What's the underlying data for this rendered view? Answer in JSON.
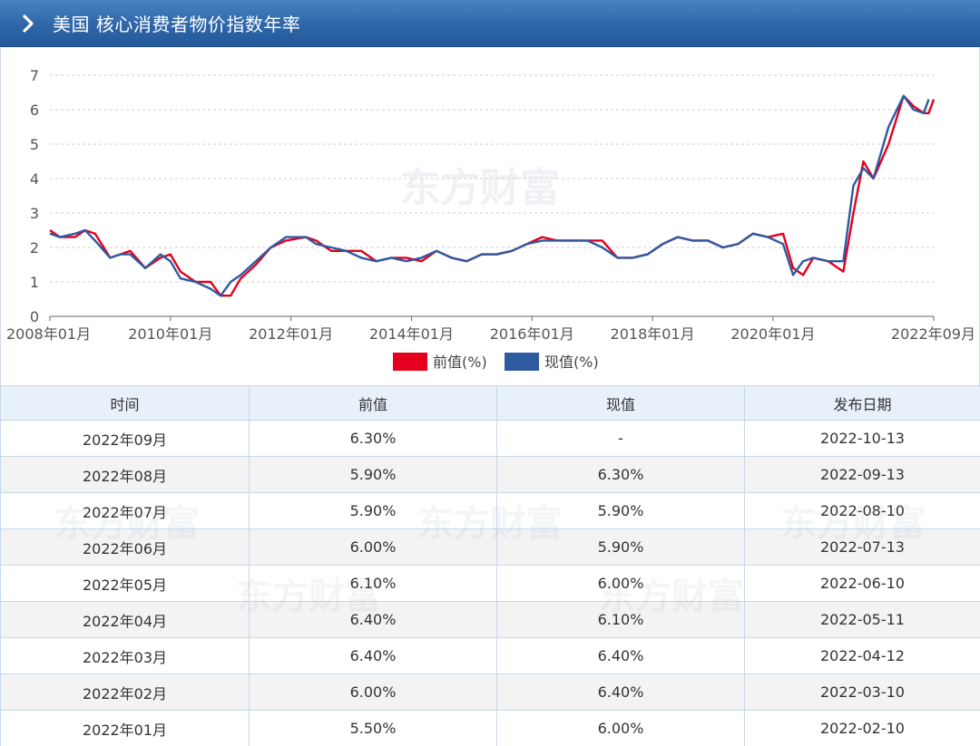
{
  "header": {
    "title": "美国 核心消费者物价指数年率"
  },
  "watermark": {
    "text": "东方财富"
  },
  "legend": {
    "prev_label": "前值(%)",
    "curr_label": "现值(%)"
  },
  "colors": {
    "prev": "#e4001c",
    "curr": "#2e5aa0",
    "header": "#2e66a8"
  },
  "chart_data": {
    "type": "line",
    "x_ticks": [
      "2008年01月",
      "2010年01月",
      "2012年01月",
      "2014年01月",
      "2016年01月",
      "2018年01月",
      "2020年01月",
      "2022年09月"
    ],
    "x_range": [
      "2008-01",
      "2022-09"
    ],
    "ylim": [
      0,
      7
    ],
    "y_ticks": [
      0,
      1,
      2,
      3,
      4,
      5,
      6,
      7
    ],
    "grid": "horizontal-dashed",
    "legend_position": "bottom",
    "series": [
      {
        "name": "前值(%)",
        "points": [
          [
            "2008-01",
            2.5
          ],
          [
            "2008-03",
            2.3
          ],
          [
            "2008-06",
            2.3
          ],
          [
            "2008-08",
            2.5
          ],
          [
            "2008-10",
            2.4
          ],
          [
            "2009-01",
            1.7
          ],
          [
            "2009-03",
            1.8
          ],
          [
            "2009-05",
            1.9
          ],
          [
            "2009-08",
            1.4
          ],
          [
            "2009-11",
            1.7
          ],
          [
            "2010-01",
            1.8
          ],
          [
            "2010-03",
            1.3
          ],
          [
            "2010-06",
            1.0
          ],
          [
            "2010-09",
            1.0
          ],
          [
            "2010-11",
            0.6
          ],
          [
            "2011-01",
            0.6
          ],
          [
            "2011-03",
            1.1
          ],
          [
            "2011-06",
            1.5
          ],
          [
            "2011-09",
            2.0
          ],
          [
            "2011-12",
            2.2
          ],
          [
            "2012-04",
            2.3
          ],
          [
            "2012-06",
            2.2
          ],
          [
            "2012-09",
            1.9
          ],
          [
            "2012-12",
            1.9
          ],
          [
            "2013-03",
            1.9
          ],
          [
            "2013-06",
            1.6
          ],
          [
            "2013-09",
            1.7
          ],
          [
            "2013-12",
            1.7
          ],
          [
            "2014-03",
            1.6
          ],
          [
            "2014-06",
            1.9
          ],
          [
            "2014-09",
            1.7
          ],
          [
            "2014-12",
            1.6
          ],
          [
            "2015-03",
            1.8
          ],
          [
            "2015-06",
            1.8
          ],
          [
            "2015-09",
            1.9
          ],
          [
            "2015-12",
            2.1
          ],
          [
            "2016-03",
            2.3
          ],
          [
            "2016-06",
            2.2
          ],
          [
            "2016-09",
            2.2
          ],
          [
            "2016-12",
            2.2
          ],
          [
            "2017-03",
            2.2
          ],
          [
            "2017-06",
            1.7
          ],
          [
            "2017-09",
            1.7
          ],
          [
            "2017-12",
            1.8
          ],
          [
            "2018-03",
            2.1
          ],
          [
            "2018-06",
            2.3
          ],
          [
            "2018-09",
            2.2
          ],
          [
            "2018-12",
            2.2
          ],
          [
            "2019-03",
            2.0
          ],
          [
            "2019-06",
            2.1
          ],
          [
            "2019-09",
            2.4
          ],
          [
            "2019-12",
            2.3
          ],
          [
            "2020-03",
            2.4
          ],
          [
            "2020-05",
            1.4
          ],
          [
            "2020-07",
            1.2
          ],
          [
            "2020-09",
            1.7
          ],
          [
            "2020-12",
            1.6
          ],
          [
            "2021-03",
            1.3
          ],
          [
            "2021-05",
            3.0
          ],
          [
            "2021-07",
            4.5
          ],
          [
            "2021-09",
            4.0
          ],
          [
            "2021-12",
            5.0
          ],
          [
            "2022-03",
            6.4
          ],
          [
            "2022-05",
            6.1
          ],
          [
            "2022-07",
            5.9
          ],
          [
            "2022-08",
            5.9
          ],
          [
            "2022-09",
            6.3
          ]
        ]
      },
      {
        "name": "现值(%)",
        "points": [
          [
            "2008-01",
            2.4
          ],
          [
            "2008-03",
            2.3
          ],
          [
            "2008-06",
            2.4
          ],
          [
            "2008-08",
            2.5
          ],
          [
            "2008-10",
            2.2
          ],
          [
            "2009-01",
            1.7
          ],
          [
            "2009-03",
            1.8
          ],
          [
            "2009-05",
            1.8
          ],
          [
            "2009-08",
            1.4
          ],
          [
            "2009-11",
            1.8
          ],
          [
            "2010-01",
            1.6
          ],
          [
            "2010-03",
            1.1
          ],
          [
            "2010-06",
            1.0
          ],
          [
            "2010-09",
            0.8
          ],
          [
            "2010-11",
            0.6
          ],
          [
            "2011-01",
            1.0
          ],
          [
            "2011-03",
            1.2
          ],
          [
            "2011-06",
            1.6
          ],
          [
            "2011-09",
            2.0
          ],
          [
            "2011-12",
            2.3
          ],
          [
            "2012-04",
            2.3
          ],
          [
            "2012-06",
            2.1
          ],
          [
            "2012-09",
            2.0
          ],
          [
            "2012-12",
            1.9
          ],
          [
            "2013-03",
            1.7
          ],
          [
            "2013-06",
            1.6
          ],
          [
            "2013-09",
            1.7
          ],
          [
            "2013-12",
            1.6
          ],
          [
            "2014-03",
            1.7
          ],
          [
            "2014-06",
            1.9
          ],
          [
            "2014-09",
            1.7
          ],
          [
            "2014-12",
            1.6
          ],
          [
            "2015-03",
            1.8
          ],
          [
            "2015-06",
            1.8
          ],
          [
            "2015-09",
            1.9
          ],
          [
            "2015-12",
            2.1
          ],
          [
            "2016-03",
            2.2
          ],
          [
            "2016-06",
            2.2
          ],
          [
            "2016-09",
            2.2
          ],
          [
            "2016-12",
            2.2
          ],
          [
            "2017-03",
            2.0
          ],
          [
            "2017-06",
            1.7
          ],
          [
            "2017-09",
            1.7
          ],
          [
            "2017-12",
            1.8
          ],
          [
            "2018-03",
            2.1
          ],
          [
            "2018-06",
            2.3
          ],
          [
            "2018-09",
            2.2
          ],
          [
            "2018-12",
            2.2
          ],
          [
            "2019-03",
            2.0
          ],
          [
            "2019-06",
            2.1
          ],
          [
            "2019-09",
            2.4
          ],
          [
            "2019-12",
            2.3
          ],
          [
            "2020-03",
            2.1
          ],
          [
            "2020-05",
            1.2
          ],
          [
            "2020-07",
            1.6
          ],
          [
            "2020-09",
            1.7
          ],
          [
            "2020-12",
            1.6
          ],
          [
            "2021-03",
            1.6
          ],
          [
            "2021-05",
            3.8
          ],
          [
            "2021-07",
            4.3
          ],
          [
            "2021-09",
            4.0
          ],
          [
            "2021-12",
            5.5
          ],
          [
            "2022-03",
            6.4
          ],
          [
            "2022-05",
            6.0
          ],
          [
            "2022-07",
            5.9
          ],
          [
            "2022-08",
            6.3
          ]
        ]
      }
    ]
  },
  "table": {
    "headers": [
      "时间",
      "前值",
      "现值",
      "发布日期"
    ],
    "rows": [
      [
        "2022年09月",
        "6.30%",
        "-",
        "2022-10-13"
      ],
      [
        "2022年08月",
        "5.90%",
        "6.30%",
        "2022-09-13"
      ],
      [
        "2022年07月",
        "5.90%",
        "5.90%",
        "2022-08-10"
      ],
      [
        "2022年06月",
        "6.00%",
        "5.90%",
        "2022-07-13"
      ],
      [
        "2022年05月",
        "6.10%",
        "6.00%",
        "2022-06-10"
      ],
      [
        "2022年04月",
        "6.40%",
        "6.10%",
        "2022-05-11"
      ],
      [
        "2022年03月",
        "6.40%",
        "6.40%",
        "2022-04-12"
      ],
      [
        "2022年02月",
        "6.00%",
        "6.40%",
        "2022-03-10"
      ],
      [
        "2022年01月",
        "5.50%",
        "6.00%",
        "2022-02-10"
      ]
    ]
  }
}
